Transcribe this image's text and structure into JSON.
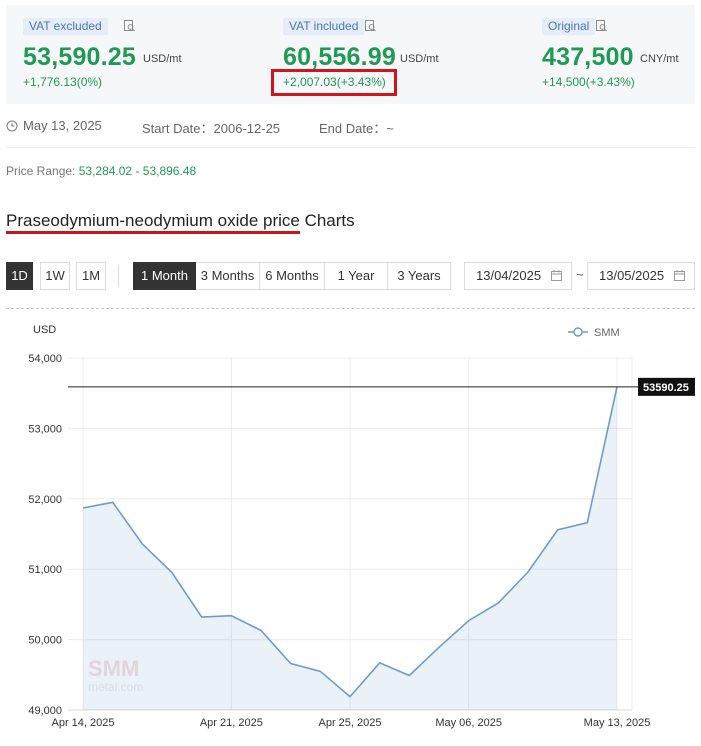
{
  "prices": [
    {
      "tag": "VAT excluded",
      "value": "53,590.25",
      "unit": "USD/mt",
      "change": "+1,776.13(0%)"
    },
    {
      "tag": "VAT included",
      "value": "60,556.99",
      "unit": "USD/mt",
      "change": "+2,007.03(+3.43%)"
    },
    {
      "tag": "Original",
      "value": "437,500",
      "unit": "CNY/mt",
      "change": "+14,500(+3.43%)"
    }
  ],
  "dates": {
    "current": "May 13, 2025",
    "start": "Start Date：2006-12-25",
    "end": "End Date：~"
  },
  "price_range": {
    "label": "Price Range:",
    "value": "53,284.02 - 53,896.48"
  },
  "title": {
    "underlined": "Praseodymium-neodymium oxide price",
    "rest": " Charts"
  },
  "interval_buttons": [
    "1D",
    "1W",
    "1M"
  ],
  "period_buttons": [
    "1 Month",
    "3 Months",
    "6 Months",
    "1 Year",
    "3 Years"
  ],
  "date_from": "13/04/2025",
  "date_to": "13/05/2025",
  "date_separator": "~",
  "colors": {
    "accent_green": "#1f9a55",
    "highlight_red": "#d4141c",
    "series": "#6d9cc8"
  },
  "chart_data": {
    "type": "area",
    "ylabel": "USD",
    "legend": [
      "SMM"
    ],
    "legend_position": "top-right",
    "ylim": [
      49000,
      54000
    ],
    "yticks": [
      "54,000",
      "53,000",
      "52,000",
      "51,000",
      "50,000",
      "49,000"
    ],
    "xticks": [
      "Apr 14, 2025",
      "Apr 21, 2025",
      "Apr 25, 2025",
      "May 06, 2025",
      "May 13, 2025"
    ],
    "x": [
      "Apr 14",
      "Apr 15",
      "Apr 16",
      "Apr 17",
      "Apr 18",
      "Apr 21",
      "Apr 22",
      "Apr 23",
      "Apr 24",
      "Apr 25",
      "Apr 28",
      "Apr 29",
      "Apr 30",
      "May 06",
      "May 07",
      "May 08",
      "May 09",
      "May 12",
      "May 13"
    ],
    "series": [
      {
        "name": "SMM",
        "values": [
          51870,
          51950,
          51360,
          50950,
          50320,
          50340,
          50130,
          49660,
          49550,
          49190,
          49670,
          49490,
          49890,
          50270,
          50520,
          50960,
          51560,
          51660,
          53590.25
        ]
      }
    ],
    "reference_line": {
      "value": 53590.25,
      "label": "53590.25"
    },
    "watermark": "SMM metal.com",
    "grid": true
  }
}
